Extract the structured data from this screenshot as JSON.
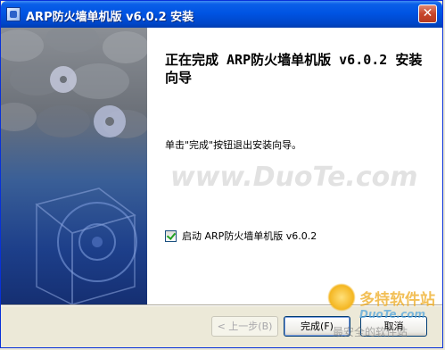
{
  "window": {
    "title": "ARP防火墙单机版 v6.0.2 安装",
    "close_label": "✕"
  },
  "content": {
    "heading": "正在完成 ARP防火墙单机版 v6.0.2 安装向导",
    "finish_text": "单击\"完成\"按钮退出安装向导。",
    "launch_checkbox": {
      "label": "启动 ARP防火墙单机版 v6.0.2",
      "checked": true
    }
  },
  "buttons": {
    "back": "< 上一步(B)",
    "finish": "完成(F)",
    "cancel": "取消"
  },
  "watermarks": {
    "center": "www.DuoTe.com",
    "corner_line1": "多特软件站",
    "corner_line2": "DuoTe.com",
    "corner_line3": "最安全的软件站"
  },
  "icons": [
    "app-icon",
    "close-icon",
    "checkbox-checked-icon",
    "installer-banner-image"
  ],
  "colors": {
    "titlebar": "#0054e3",
    "face": "#ece9d8",
    "banner": "#1d3f8a"
  }
}
